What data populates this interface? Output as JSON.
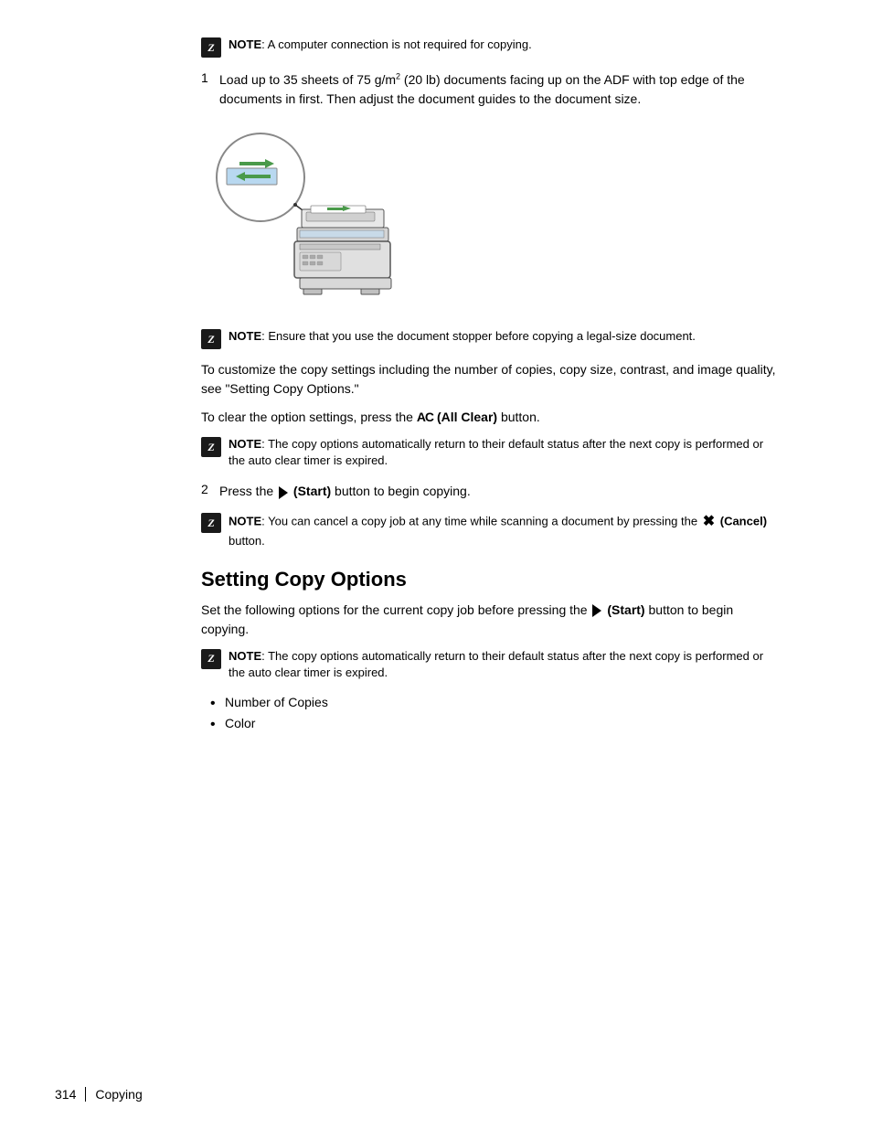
{
  "page": {
    "footer": {
      "page_number": "314",
      "divider": "|",
      "section": "Copying"
    }
  },
  "notes": {
    "note1": {
      "icon": "Z",
      "text": "NOTE: A computer connection is not required for copying."
    },
    "note2": {
      "icon": "Z",
      "text": "NOTE: Ensure that you use the document stopper before copying a legal-size document."
    },
    "note3": {
      "icon": "Z",
      "text": "NOTE: The copy options automatically return to their default status after the next copy is performed or the auto clear timer is expired."
    },
    "note4": {
      "icon": "Z",
      "text_prefix": "NOTE: You can cancel a copy job at any time while scanning a document by pressing the",
      "text_suffix": "(Cancel) button."
    },
    "note5": {
      "icon": "Z",
      "text": "NOTE: The copy options automatically return to their default status after the next copy is performed or the auto clear timer is expired."
    }
  },
  "steps": {
    "step1": {
      "number": "1",
      "text_prefix": "Load up to 35 sheets of 75 g/m",
      "superscript": "2",
      "text_suffix": " (20 lb) documents facing up on the ADF with top edge of the documents in first. Then adjust the document guides to the document size."
    },
    "step2": {
      "number": "2",
      "text_prefix": "Press the",
      "button_label": "(Start)",
      "text_suffix": "button to begin copying."
    }
  },
  "paragraphs": {
    "para1": "To customize the copy settings including the number of copies, copy size, contrast, and image quality, see \"Setting Copy Options.\"",
    "para2_prefix": "To clear the option settings, press the",
    "para2_ac": "AC",
    "para2_strong": "(All Clear)",
    "para2_suffix": "button."
  },
  "section": {
    "heading": "Setting Copy Options",
    "description_prefix": "Set the following options for the current copy job before pressing the",
    "description_button": "(Start)",
    "description_suffix": "button to begin copying.",
    "bullet_items": [
      "Number of Copies",
      "Color"
    ]
  }
}
